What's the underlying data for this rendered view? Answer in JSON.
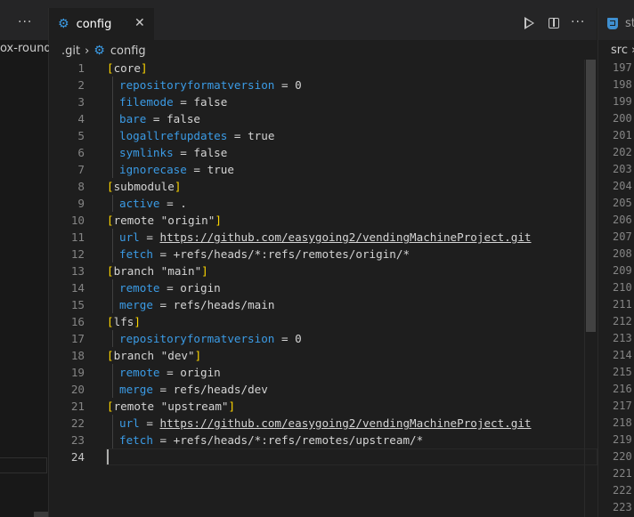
{
  "left_panel": {
    "crumb": "ox-round",
    "more": "···"
  },
  "editor": {
    "tab_label": "config",
    "tab_close": "✕",
    "more": "···",
    "icons": {
      "file": "gear-icon",
      "run": "play-icon",
      "split": "split-editor-icon"
    },
    "breadcrumb": [
      ".git",
      "config"
    ],
    "breadcrumb_sep": "›",
    "accent": "#3b9be5",
    "lines": [
      {
        "n": "1",
        "section": "core",
        "indent": false
      },
      {
        "n": "2",
        "key": "repositoryformatversion",
        "value": "0",
        "indent": true
      },
      {
        "n": "3",
        "key": "filemode",
        "value": "false",
        "indent": true
      },
      {
        "n": "4",
        "key": "bare",
        "value": "false",
        "indent": true
      },
      {
        "n": "5",
        "key": "logallrefupdates",
        "value": "true",
        "indent": true
      },
      {
        "n": "6",
        "key": "symlinks",
        "value": "false",
        "indent": true
      },
      {
        "n": "7",
        "key": "ignorecase",
        "value": "true",
        "indent": true
      },
      {
        "n": "8",
        "section": "submodule",
        "indent": false
      },
      {
        "n": "9",
        "key": "active",
        "value": ".",
        "indent": true
      },
      {
        "n": "10",
        "section": "remote \"origin\"",
        "indent": false
      },
      {
        "n": "11",
        "key": "url",
        "link": "https://github.com/easygoing2/vendingMachineProject.git",
        "indent": true
      },
      {
        "n": "12",
        "key": "fetch",
        "value": "+refs/heads/*:refs/remotes/origin/*",
        "indent": true
      },
      {
        "n": "13",
        "section": "branch \"main\"",
        "indent": false
      },
      {
        "n": "14",
        "key": "remote",
        "value": "origin",
        "indent": true
      },
      {
        "n": "15",
        "key": "merge",
        "value": "refs/heads/main",
        "indent": true
      },
      {
        "n": "16",
        "section": "lfs",
        "indent": false
      },
      {
        "n": "17",
        "key": "repositoryformatversion",
        "value": "0",
        "indent": true
      },
      {
        "n": "18",
        "section": "branch \"dev\"",
        "indent": false
      },
      {
        "n": "19",
        "key": "remote",
        "value": "origin",
        "indent": true
      },
      {
        "n": "20",
        "key": "merge",
        "value": "refs/heads/dev",
        "indent": true
      },
      {
        "n": "21",
        "section": "remote \"upstream\"",
        "indent": false
      },
      {
        "n": "22",
        "key": "url",
        "link": "https://github.com/easygoing2/vendingMachineProject.git",
        "indent": true
      },
      {
        "n": "23",
        "key": "fetch",
        "value": "+refs/heads/*:refs/remotes/upstream/*",
        "indent": true
      },
      {
        "n": "24",
        "empty": true,
        "current": true
      }
    ]
  },
  "right_panel": {
    "tab_label": "st",
    "crumb": "src ›",
    "icon": "css-file-icon",
    "line_numbers": [
      "197",
      "198",
      "199",
      "200",
      "201",
      "202",
      "203",
      "204",
      "205",
      "206",
      "207",
      "208",
      "209",
      "210",
      "211",
      "212",
      "213",
      "214",
      "215",
      "216",
      "217",
      "218",
      "219",
      "220",
      "221",
      "222",
      "223"
    ]
  }
}
